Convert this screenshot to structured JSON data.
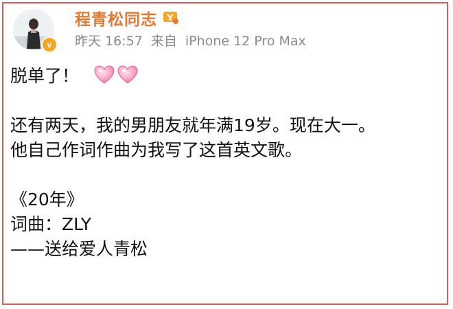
{
  "post": {
    "author": "程青松同志",
    "meta": {
      "time": "昨天 16:57",
      "source_prefix": "来自",
      "device": "iPhone 12 Pro Max"
    },
    "lines": [
      "脱单了！",
      "还有两天，我的男朋友就年满19岁。现在大一。",
      "他自己作词作曲为我写了这首英文歌。",
      "《20年》",
      "词曲：ZLY",
      "——送给爱人青松"
    ],
    "verified_badge": "v",
    "icons": {
      "avatar": "avatar",
      "verified": "verified-badge-icon",
      "vip": "vip-badge-icon",
      "heart": "pink-heart-icon"
    },
    "colors": {
      "username": "#e8772e",
      "meta": "#8a8a8a",
      "frame": "#e05a5a",
      "heart": "#f48fb1",
      "badge": "#f5a623"
    }
  }
}
